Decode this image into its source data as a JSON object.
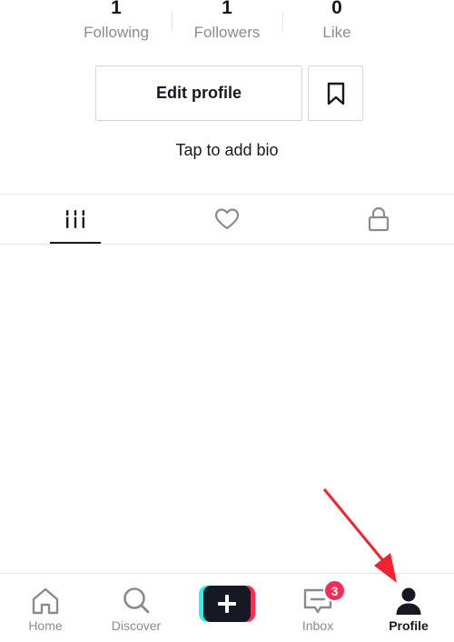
{
  "stats": {
    "following": {
      "count": "1",
      "label": "Following"
    },
    "followers": {
      "count": "1",
      "label": "Followers"
    },
    "likes": {
      "count": "0",
      "label": "Like"
    }
  },
  "profile": {
    "edit_label": "Edit profile",
    "bio_placeholder": "Tap to add bio"
  },
  "tabs": [
    {
      "icon": "videos-grid-icon",
      "active": true
    },
    {
      "icon": "heart-icon",
      "active": false
    },
    {
      "icon": "lock-icon",
      "active": false
    }
  ],
  "nav": {
    "home": "Home",
    "discover": "Discover",
    "inbox": "Inbox",
    "inbox_badge": "3",
    "profile": "Profile"
  },
  "colors": {
    "text": "#161823",
    "muted": "#8a8b91",
    "accent_pink": "#fe2c55",
    "accent_cyan": "#25f4ee",
    "annotation_arrow": "#f5222d"
  }
}
